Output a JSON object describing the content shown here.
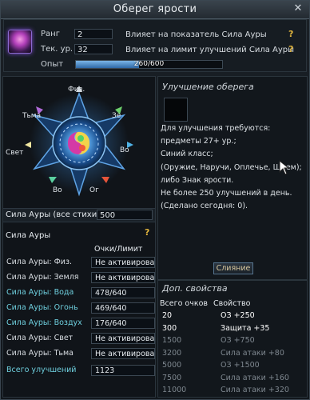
{
  "window": {
    "title": "Оберег ярости",
    "close_glyph": "✕"
  },
  "header": {
    "rank_label": "Ранг",
    "rank_value": "2",
    "rank_desc": "Влияет на показатель Сила Ауры",
    "level_label": "Тек. ур.",
    "level_value": "32",
    "level_desc": "Влияет на лимит улучшений Сила Ауры",
    "exp_label": "Опыт",
    "exp_text": "260/600",
    "exp_progress": 0.433,
    "help_glyph": "?"
  },
  "compass": {
    "elements": {
      "phys": "Физ.",
      "earth": "Зе",
      "water": "Во",
      "fire": "Ог",
      "air": "Во",
      "light": "Свет",
      "dark": "Тьма"
    }
  },
  "aura_all": {
    "label": "Сила Ауры (все стихии)",
    "value": "500"
  },
  "aura_section": {
    "title": "Сила Ауры",
    "column_header": "Очки/Лимит",
    "help_glyph": "?",
    "rows": [
      {
        "label": "Сила Ауры: Физ.",
        "value": "Не активировано.",
        "color": "#d8dde2"
      },
      {
        "label": "Сила Ауры: Земля",
        "value": "Не активировано.",
        "color": "#d8dde2"
      },
      {
        "label": "Сила Ауры: Вода",
        "value": "478/640",
        "color": "#6fd0df"
      },
      {
        "label": "Сила Ауры: Огонь",
        "value": "469/640",
        "color": "#6fd0df"
      },
      {
        "label": "Сила Ауры: Воздух",
        "value": "176/640",
        "color": "#6fd0df"
      },
      {
        "label": "Сила Ауры: Свет",
        "value": "Не активировано.",
        "color": "#d8dde2"
      },
      {
        "label": "Сила Ауры: Тьма",
        "value": "Не активировано.",
        "color": "#d8dde2"
      }
    ],
    "total_label": "Всего улучшений",
    "total_value": "1123",
    "total_color": "#6fd0df"
  },
  "upgrade": {
    "title": "Улучшение оберега",
    "requirements": [
      "Для улучшения требуются:",
      "предметы 27+ ур.;",
      "Синий класс;",
      "(Оружие, Наручи, Оплечье, Шлем);",
      "либо Знак ярости.",
      "Не более 250 улучшений в день.",
      "(Сделано сегодня: 0)."
    ],
    "merge_button": "Слияние"
  },
  "extra": {
    "title": "Доп. свойства",
    "col_points": "Всего очков",
    "col_property": "Свойство",
    "rows": [
      {
        "points": "20",
        "property": "ОЗ +250",
        "active": true
      },
      {
        "points": "300",
        "property": "Защита +35",
        "active": true
      },
      {
        "points": "1500",
        "property": "ОЗ +750",
        "active": false
      },
      {
        "points": "3200",
        "property": "Сила атаки +80",
        "active": false
      },
      {
        "points": "5000",
        "property": "ОЗ +1500",
        "active": false
      },
      {
        "points": "7500",
        "property": "Сила атаки +160",
        "active": false
      },
      {
        "points": "11000",
        "property": "Сила атаки +320",
        "active": false
      }
    ]
  },
  "colors": {
    "active_text": "#ffffff",
    "inactive_text": "#7e878f",
    "accent_cyan": "#6fd0df",
    "help_yellow": "#e0b43d"
  }
}
